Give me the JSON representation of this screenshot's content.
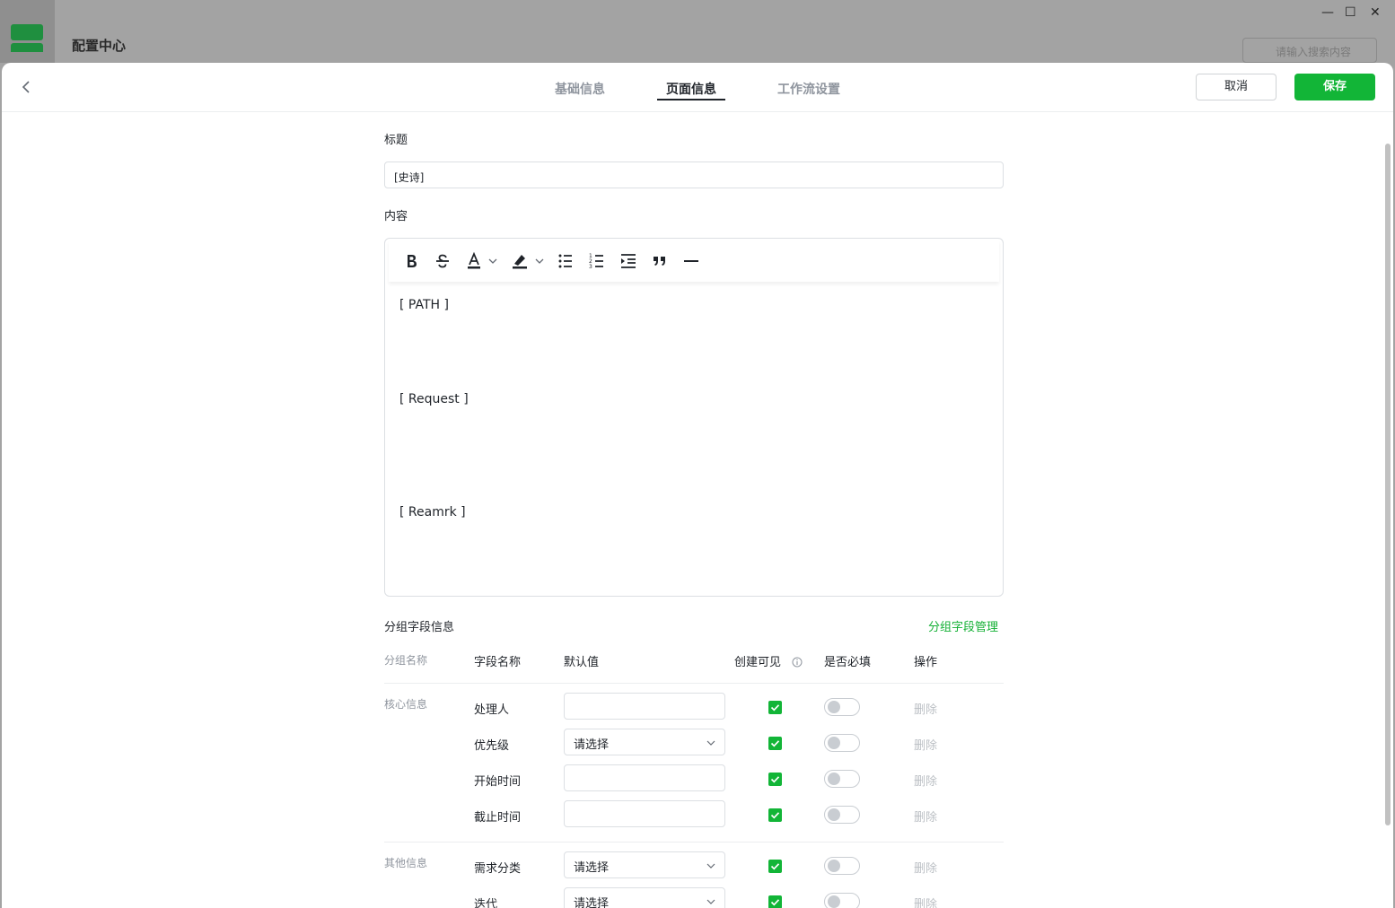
{
  "background_app": {
    "title": "配置中心",
    "search_placeholder": "请输入搜索内容",
    "minimize": "—",
    "maximize": "☐",
    "close": "✕"
  },
  "header": {
    "tabs": [
      {
        "label": "基础信息",
        "active": false
      },
      {
        "label": "页面信息",
        "active": true
      },
      {
        "label": "工作流设置",
        "active": false
      }
    ],
    "cancel_label": "取消",
    "save_label": "保存"
  },
  "form": {
    "title_label": "标题",
    "title_value": "[史诗]",
    "content_label": "内容",
    "editor_lines": [
      "[ PATH ]",
      "[ Request ]",
      "[ Reamrk ]"
    ],
    "toolbar_icons": [
      "bold-icon",
      "strikethrough-icon",
      "font-color-icon",
      "highlight-icon",
      "bullet-list-icon",
      "ordered-list-icon",
      "indent-icon",
      "quote-icon",
      "horizontal-rule-icon"
    ]
  },
  "fields_section": {
    "title": "分组字段信息",
    "manage_link": "分组字段管理",
    "columns": {
      "group": "分组名称",
      "field": "字段名称",
      "default": "默认值",
      "visible": "创建可见",
      "required": "是否必填",
      "action": "操作"
    },
    "rows": [
      {
        "group": "核心信息",
        "field": "处理人",
        "default": "",
        "select": false,
        "visible": true,
        "required": false,
        "action": "删除"
      },
      {
        "group": "",
        "field": "优先级",
        "default": "请选择",
        "select": true,
        "visible": true,
        "required": false,
        "action": "删除"
      },
      {
        "group": "",
        "field": "开始时间",
        "default": "",
        "select": false,
        "visible": true,
        "required": false,
        "action": "删除"
      },
      {
        "group": "",
        "field": "截止时间",
        "default": "",
        "select": false,
        "visible": true,
        "required": false,
        "action": "删除"
      },
      {
        "group": "其他信息",
        "field": "需求分类",
        "default": "请选择",
        "select": true,
        "visible": true,
        "required": false,
        "action": "删除"
      },
      {
        "group": "",
        "field": "迭代",
        "default": "请选择",
        "select": true,
        "visible": true,
        "required": false,
        "action": "删除"
      }
    ]
  },
  "colors": {
    "accent": "#12b537",
    "muted": "#8f959e"
  }
}
